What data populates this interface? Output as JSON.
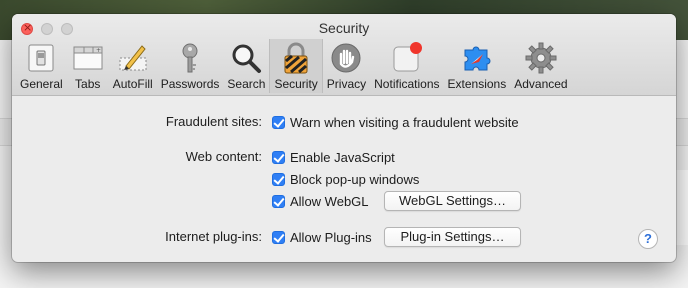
{
  "window": {
    "title": "Security"
  },
  "toolbar": {
    "items": [
      {
        "label": "General",
        "icon": "general-switch-icon"
      },
      {
        "label": "Tabs",
        "icon": "tabs-icon"
      },
      {
        "label": "AutoFill",
        "icon": "autofill-pencil-icon"
      },
      {
        "label": "Passwords",
        "icon": "key-icon"
      },
      {
        "label": "Search",
        "icon": "magnifier-icon"
      },
      {
        "label": "Security",
        "icon": "padlock-icon"
      },
      {
        "label": "Privacy",
        "icon": "hand-icon"
      },
      {
        "label": "Notifications",
        "icon": "notification-badge-icon"
      },
      {
        "label": "Extensions",
        "icon": "puzzle-piece-icon"
      },
      {
        "label": "Advanced",
        "icon": "gear-icon"
      }
    ],
    "selected": "Security"
  },
  "settings": {
    "fraudulent": {
      "label": "Fraudulent sites:",
      "option": "Warn when visiting a fraudulent website",
      "checked": true
    },
    "web_content": {
      "label": "Web content:",
      "javascript": {
        "option": "Enable JavaScript",
        "checked": true
      },
      "popups": {
        "option": "Block pop-up windows",
        "checked": true
      },
      "webgl": {
        "option": "Allow WebGL",
        "checked": true,
        "button": "WebGL Settings…"
      }
    },
    "plugins": {
      "label": "Internet plug-ins:",
      "option": "Allow Plug-ins",
      "checked": true,
      "button": "Plug-in Settings…"
    }
  },
  "help": {
    "label": "?"
  },
  "colors": {
    "accent": "#2f7ff5",
    "close": "#fc605b"
  }
}
